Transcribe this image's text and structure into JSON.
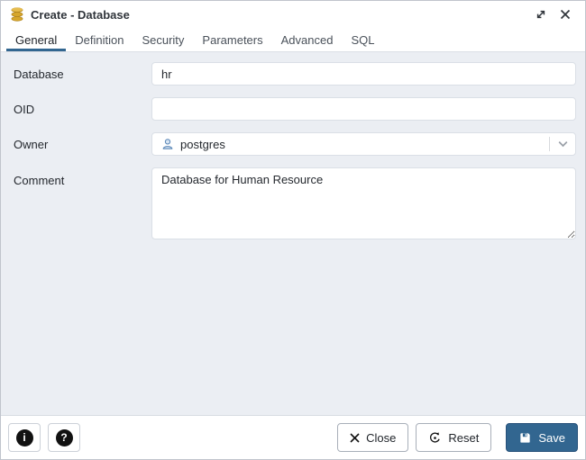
{
  "window": {
    "title": "Create - Database",
    "icon": "database-icon"
  },
  "tabs": {
    "items": [
      {
        "label": "General",
        "active": true
      },
      {
        "label": "Definition",
        "active": false
      },
      {
        "label": "Security",
        "active": false
      },
      {
        "label": "Parameters",
        "active": false
      },
      {
        "label": "Advanced",
        "active": false
      },
      {
        "label": "SQL",
        "active": false
      }
    ]
  },
  "form": {
    "database": {
      "label": "Database",
      "value": "hr"
    },
    "oid": {
      "label": "OID",
      "value": ""
    },
    "owner": {
      "label": "Owner",
      "value": "postgres",
      "icon": "user-icon"
    },
    "comment": {
      "label": "Comment",
      "value": "Database for Human Resource"
    }
  },
  "footer": {
    "info_button": {
      "glyph": "i",
      "icon": "info-icon"
    },
    "help_button": {
      "glyph": "?",
      "icon": "question-icon"
    },
    "close_button": {
      "label": "Close",
      "icon": "x-icon"
    },
    "reset_button": {
      "label": "Reset",
      "icon": "reset-icon"
    },
    "save_button": {
      "label": "Save",
      "icon": "save-icon"
    }
  },
  "colors": {
    "accent": "#326690",
    "form_background": "#ebeef3",
    "bar_background": "#ffffff",
    "database_icon_gold": "#d6a62c"
  }
}
